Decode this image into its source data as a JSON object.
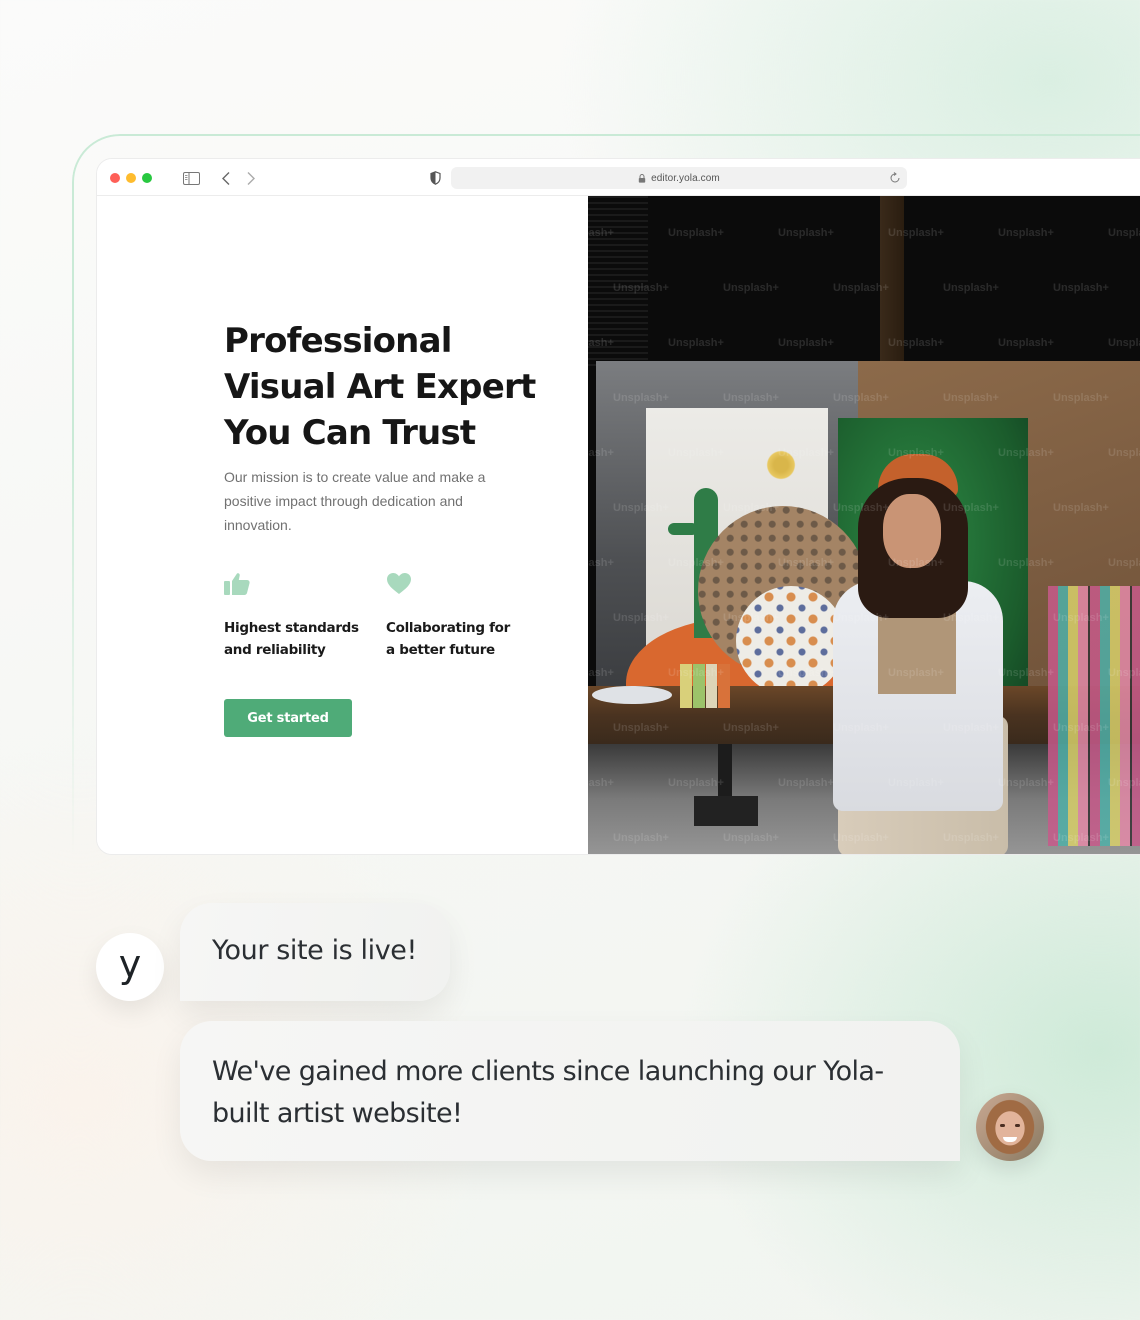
{
  "browser": {
    "traffic_lights": {
      "close": "#fe5f57",
      "minimize": "#febc2e",
      "maximize": "#28c840"
    },
    "toolbar_icons": [
      "sidebar-icon",
      "back-icon",
      "forward-icon",
      "shield-icon",
      "lock-icon",
      "reload-icon"
    ],
    "url": "editor.yola.com"
  },
  "site": {
    "headline": [
      "Professional",
      "Visual Art Expert",
      "You Can Trust"
    ],
    "mission": "Our mission is to create value and make a positive impact through dedication and innovation.",
    "features": [
      {
        "icon": "thumbs-up-icon",
        "title": [
          "Highest standards",
          "and reliability"
        ]
      },
      {
        "icon": "heart-icon",
        "title": [
          "Collaborating for",
          "a better future"
        ]
      }
    ],
    "cta_label": "Get started",
    "accent_color": "#4fab78",
    "icon_color": "#a8d9bd",
    "hero_image": {
      "description": "Artist seated in studio in front of paintings",
      "watermark": "Unsplash+"
    }
  },
  "chat": {
    "messages": [
      {
        "sender": "yola",
        "avatar": "yola-logo",
        "text": "Your site is live!"
      },
      {
        "sender": "user",
        "avatar": "user-photo",
        "text": "We've gained more clients since launching our Yola-built artist website!"
      }
    ],
    "yola_logo_glyph": "y"
  }
}
